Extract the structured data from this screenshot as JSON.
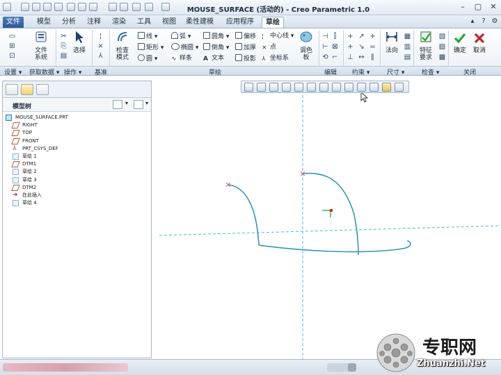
{
  "window": {
    "title": "MOUSE_SURFACE (活动的) - Creo Parametric 1.0"
  },
  "menu_tabs": [
    "文件",
    "模型",
    "分析",
    "注释",
    "渲染",
    "工具",
    "视图",
    "柔性建模",
    "应用程序",
    "草绘"
  ],
  "active_tab": "草绘",
  "ribbon": {
    "setup": {
      "file_system_label": "文件\n系统"
    },
    "operations": {
      "select_label": "选择"
    },
    "datum": {},
    "sketch": {
      "inspection_mode_label": "检查\n模式",
      "line": "线",
      "arc": "弧",
      "fillet": "圆角",
      "offset": "偏移",
      "centerline": "中心线",
      "rectangle": "矩形",
      "ellipse": "椭圆",
      "chamfer": "倒角",
      "thicken": "加厚",
      "point": "点",
      "circle": "圆",
      "spline": "样条",
      "text": "文本",
      "project": "投影",
      "coord_system": "坐标系",
      "palette_label": "调色\n板"
    },
    "dimension": {
      "normal_label": "法向"
    },
    "inspect": {
      "feature_req_label": "特征\n要求"
    },
    "close": {
      "ok_label": "确定",
      "cancel_label": "取消"
    },
    "group_labels": [
      "设置",
      "获取数据",
      "操作",
      "基准",
      "草绘",
      "编辑",
      "约束",
      "尺寸",
      "检查",
      "关闭"
    ]
  },
  "model_tree": {
    "header": "模型树",
    "items": [
      {
        "label": "MOUSE_SURFACE.PRT",
        "icon": "part-icon"
      },
      {
        "label": "RIGHT",
        "icon": "datum-plane-icon"
      },
      {
        "label": "TOP",
        "icon": "datum-plane-icon"
      },
      {
        "label": "FRONT",
        "icon": "datum-plane-icon"
      },
      {
        "label": "PRT_CSYS_DEF",
        "icon": "csys-icon"
      },
      {
        "label": "草绘 1",
        "icon": "sketch-icon"
      },
      {
        "label": "DTM1",
        "icon": "datum-plane-icon"
      },
      {
        "label": "草绘 2",
        "icon": "sketch-icon"
      },
      {
        "label": "草绘 3",
        "icon": "sketch-icon"
      },
      {
        "label": "DTM2",
        "icon": "datum-plane-icon"
      },
      {
        "label": "在此插入",
        "icon": "insert-here-icon"
      },
      {
        "label": "草绘 4",
        "icon": "sketch-icon"
      }
    ]
  },
  "colors": {
    "sketch_curve": "#2f98b6",
    "centerline": "#3cc0d6",
    "accent": "#2d5a96",
    "ok_green": "#26a33a",
    "cancel_red": "#c0262a"
  },
  "watermark": {
    "cn": "专职网",
    "url": "Zhuanzhi.Net"
  }
}
